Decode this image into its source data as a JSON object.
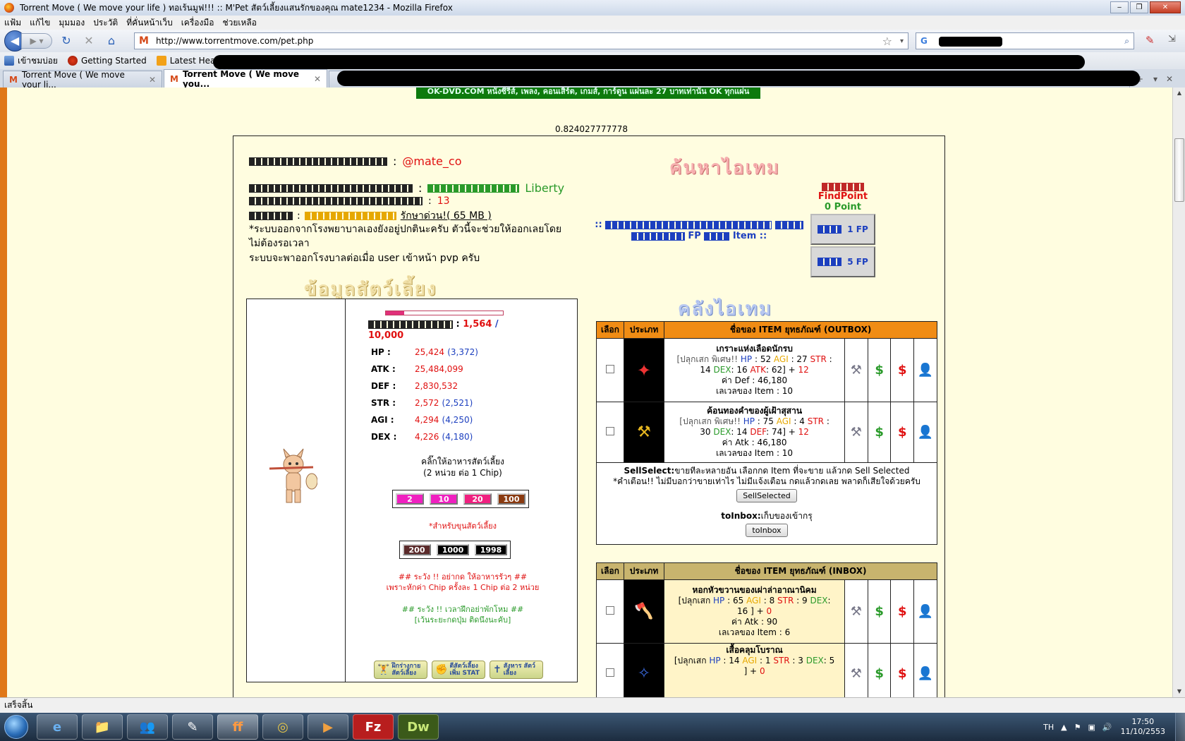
{
  "window": {
    "title": "Torrent Move ( We move your life ) ทอเร้นมูฟ!!! :: M'Pet สัตว์เลี้ยงแสนรักของคุณ mate1234 - Mozilla Firefox",
    "min_glyph": "‒",
    "max_glyph": "❐",
    "close_glyph": "✕"
  },
  "menu": [
    "แฟ้ม",
    "แก้ไข",
    "มุมมอง",
    "ประวัติ",
    "ที่คั่นหน้าเว็บ",
    "เครื่องมือ",
    "ช่วยเหลือ"
  ],
  "nav": {
    "back_glyph": "◀",
    "forward_glyph": "▶ ▾",
    "reload_glyph": "↻",
    "stop_glyph": "✕",
    "home_glyph": "⌂",
    "url": "http://www.torrentmove.com/pet.php",
    "site_icon": "M",
    "star_glyph": "☆",
    "dropdown_glyph": "▾",
    "search_engine": "G",
    "search_glyph": "⌕"
  },
  "bookmarks": [
    "เข้าชมบ่อย",
    "Getting Started",
    "Latest Headlines"
  ],
  "tabs": [
    {
      "icon": "M",
      "label": "Torrent Move ( We move your li...",
      "close": "✕"
    },
    {
      "icon": "M",
      "label": "Torrent Move ( We move you...",
      "close": "✕"
    }
  ],
  "tabs_extra": {
    "new_tab": "+",
    "list": "▾",
    "close": "✕"
  },
  "page": {
    "banner": "OK-DVD.COM หนังซีรีส์, เพลง, คอนเสิร์ต, เกมส์, การ์ตูน แผ่นละ 27 บาทเท่านั้น OK ทุกแผ่น",
    "rate": "0.824027777778",
    "owner_name": "@mate_co",
    "pet_name": "Liberty",
    "pet_level": "13",
    "care_link": "รักษาด่วน!( 65 MB )",
    "hospital_note1": "*ระบบออกจากโรงพยาบาลเองยังอยู่ปกตินะครับ ตัวนี้จะช่วยให้ออกเลยโดยไม่ต้องรอเวลา",
    "hospital_note2": "ระบบจะพาออกโรงบาลต่อเมื่อ user เข้าหน้า pvp ครับ",
    "pet_info_heading": "ข้อมูลสัตว์เลี้ยง",
    "search_item_heading": "ค้นหาไอเทม",
    "storage_heading": "คลังไอเทม",
    "find_label": "FindPoint",
    "find_points": "0 Point",
    "fp_text_a": "FP",
    "fp_text_b": "Item ::",
    "fp_prefix": "::",
    "fp_btn1": "1 FP",
    "fp_btn2": "5 FP",
    "exp_current": "1,564",
    "exp_sep": "/",
    "exp_max": "10,000",
    "exp_ratio": 0.156,
    "stats": [
      {
        "label": "HP :",
        "value": "25,424",
        "bonus": "(3,372)"
      },
      {
        "label": "ATK :",
        "value": "25,484,099",
        "bonus": ""
      },
      {
        "label": "DEF :",
        "value": "2,830,532",
        "bonus": ""
      },
      {
        "label": "STR :",
        "value": "2,572",
        "bonus": "(2,521)"
      },
      {
        "label": "AGI :",
        "value": "4,294",
        "bonus": "(4,250)"
      },
      {
        "label": "DEX :",
        "value": "4,226",
        "bonus": "(4,180)"
      }
    ],
    "feed_title": "คลิ๊กให้อาหารสัตว์เลี้ยง",
    "feed_sub": "(2 หน่วย ต่อ 1 Chip)",
    "feed_buttons": [
      "2",
      "10",
      "20",
      "100"
    ],
    "feed_note": "*สำหรับขุนสัตว์เลี้ยง",
    "bulk_buttons": [
      "200",
      "1000",
      "1998"
    ],
    "warn1": "## ระวัง !! อย่ากด ให้อาหารรัวๆ ##",
    "warn2": "เพราะหักค่า Chip ครั้งละ 1 Chip ต่อ 2 หน่วย",
    "warn3": "## ระวัง !! เวลาฝึกอย่าพักโหม ##",
    "warn4": "[เว้นระยะกดปุ่ม ติดนึงนะคับ]",
    "actions": [
      "ฝึกร่างกาย สัตว์เลี้ยง",
      "ตีสัตว์เลี้ยง เพิ่ม STAT",
      "สังหาร สัตว์เลี้ยง"
    ],
    "outbox": {
      "headers": [
        "เลือก",
        "ประเภท",
        "ชื่อของ ITEM ยุทธภัณฑ์ (OUTBOX)"
      ],
      "items": [
        {
          "name": "เกราะแห่งเลือดนักรบ",
          "line1": [
            "[ปลุกเสก พิเศษ!! ",
            "HP",
            " : 52 ",
            "AGI",
            " : 27 ",
            "STR",
            " :"
          ],
          "line2": [
            "14 ",
            "DEX",
            ": 16 ",
            "ATK",
            ": 62] + ",
            "12"
          ],
          "line3": "ค่า Def : 46,180",
          "line4": "เลเวลของ Item : 10"
        },
        {
          "name": "ค้อนทองคำของผู้เฝ้าสุสาน",
          "line1": [
            "[ปลุกเสก พิเศษ!! ",
            "HP",
            " : 75 ",
            "AGI",
            " : 4 ",
            "STR",
            " :"
          ],
          "line2": [
            "30 ",
            "DEX",
            ": 14 ",
            "DEF",
            ": 74] + ",
            "12"
          ],
          "line3": "ค่า Atk : 46,180",
          "line4": "เลเวลของ Item : 10"
        }
      ],
      "sell_label": "SellSelect:",
      "sell_text": "ขายทีละหลายอัน เลือกกด Item ที่จะขาย แล้วกด Sell Selected",
      "sell_warn": "*คำเตือน!! ไม่มีบอกว่าขายเท่าไร ไม่มีแจ้งเตือน กดแล้วกดเลย พลาดก็เสียใจด้วยครับ",
      "sell_button": "SellSelected",
      "inbox_label": "toInbox:",
      "inbox_text": "เก็บของเข้ากรุ",
      "inbox_button": "toInbox"
    },
    "inbox": {
      "headers": [
        "เลือก",
        "ประเภท",
        "ชื่อของ ITEM ยุทธภัณฑ์ (INBOX)"
      ],
      "items": [
        {
          "name": "หอกหัวขวานของเผ่าล่าอาณานิคม",
          "line1": [
            "[ปลุกเสก ",
            "HP",
            " : 65 ",
            "AGI",
            " : 8 ",
            "STR",
            " : 9 ",
            "DEX",
            ":"
          ],
          "line2": [
            "16 ] + ",
            "0"
          ],
          "line3": "ค่า Atk : 90",
          "line4": "เลเวลของ Item : 6"
        },
        {
          "name": "เสื้อคลุมโบราณ",
          "line1": [
            "[ปลุกเสก ",
            "HP",
            " : 14 ",
            "AGI",
            " : 1 ",
            "STR",
            " : 3 ",
            "DEX",
            ": 5"
          ],
          "line2": [
            "] + ",
            "0"
          ]
        }
      ]
    }
  },
  "status": "เสร็จสิ้น",
  "taskbar": {
    "lang": "TH",
    "time": "17:50",
    "date": "11/10/2553",
    "tray_up": "▲",
    "tray_flag": "⚑",
    "tray_net": "▣",
    "tray_vol": "🔊",
    "apps": [
      "e",
      "📁",
      "👥",
      "✎",
      "ff",
      "◎",
      "▶",
      "Fz",
      "Dw"
    ]
  },
  "colors": {
    "accent": "#e07818",
    "page_bg": "#fffde0",
    "outbox_header": "#f08c14",
    "inbox_header": "#c8b46e"
  }
}
